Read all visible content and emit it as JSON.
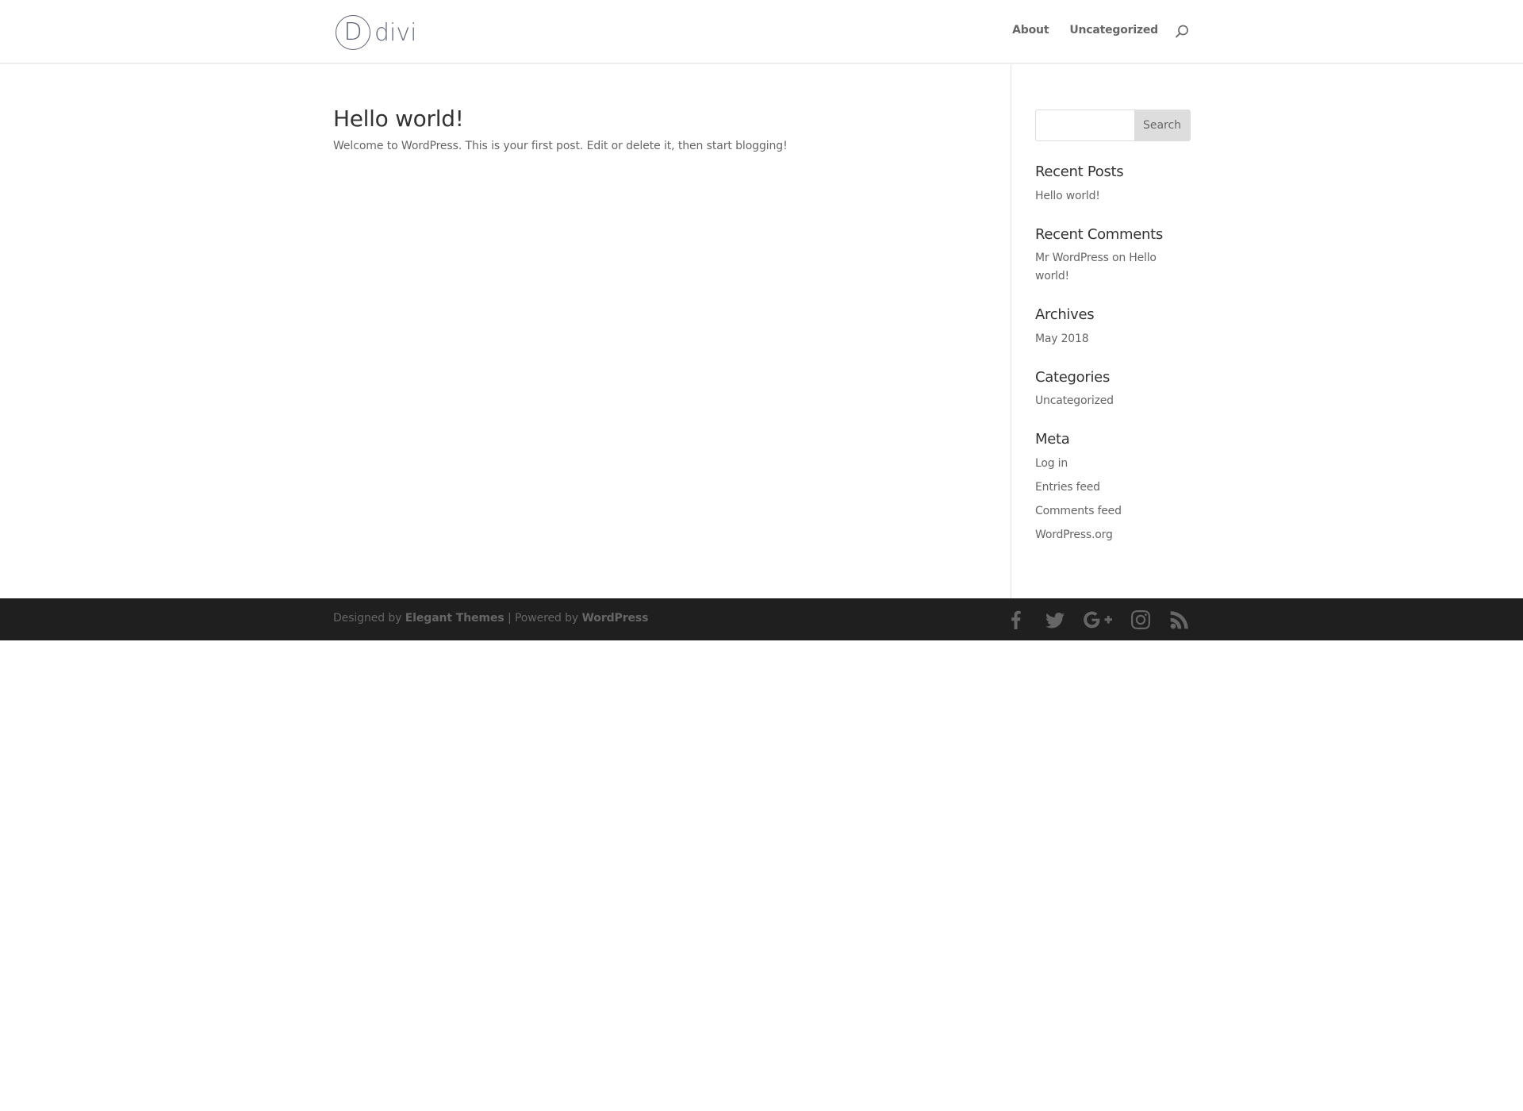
{
  "header": {
    "logo": {
      "mark": "D",
      "text": "divi"
    },
    "nav": [
      {
        "label": "About"
      },
      {
        "label": "Uncategorized"
      }
    ],
    "search_icon": "search-icon"
  },
  "post": {
    "title": "Hello world!",
    "excerpt": "Welcome to WordPress. This is your first post. Edit or delete it, then start blogging!"
  },
  "sidebar": {
    "search": {
      "value": "",
      "placeholder": "",
      "button_label": "Search"
    },
    "recent_posts": {
      "title": "Recent Posts",
      "items": [
        "Hello world!"
      ]
    },
    "recent_comments": {
      "title": "Recent Comments",
      "items": [
        {
          "author": "Mr WordPress",
          "on": "on",
          "post": "Hello world!"
        }
      ]
    },
    "archives": {
      "title": "Archives",
      "items": [
        "May 2018"
      ]
    },
    "categories": {
      "title": "Categories",
      "items": [
        "Uncategorized"
      ]
    },
    "meta": {
      "title": "Meta",
      "items": [
        "Log in",
        "Entries feed",
        "Comments feed",
        "WordPress.org"
      ]
    }
  },
  "footer": {
    "designed_by": "Designed by",
    "designer": "Elegant Themes",
    "separator": "|",
    "powered_by": "Powered by",
    "platform": "WordPress",
    "social_icons": [
      "facebook-icon",
      "twitter-icon",
      "google-plus-icon",
      "instagram-icon",
      "rss-icon"
    ]
  },
  "colors": {
    "text": "#666666",
    "heading": "#333333",
    "footer_bg": "#1f1f1f",
    "button_bg": "#dddddd",
    "border": "#e2e2e2",
    "logo": "#5d6170"
  }
}
